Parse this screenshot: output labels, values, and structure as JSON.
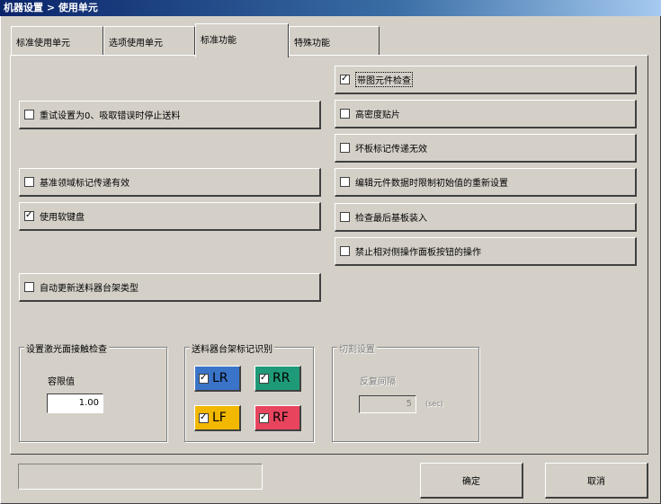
{
  "window": {
    "title": "机器设置 > 使用单元"
  },
  "tabs": [
    {
      "label": "标准使用单元"
    },
    {
      "label": "选项使用单元"
    },
    {
      "label": "标准功能"
    },
    {
      "label": "特殊功能"
    }
  ],
  "left_options": [
    {
      "label": "重试设置为0、吸取错误时停止送料",
      "checked": false
    },
    {
      "label": "基准领域标记传递有效",
      "checked": false
    },
    {
      "label": "使用软键盘",
      "checked": true
    },
    {
      "label": "自动更新送料器台架类型",
      "checked": false
    }
  ],
  "right_options": [
    {
      "label": "带图元件检查",
      "checked": true
    },
    {
      "label": "高密度贴片",
      "checked": false
    },
    {
      "label": "坏板标记传递无效",
      "checked": false
    },
    {
      "label": "编辑元件数据时限制初始值的重新设置",
      "checked": false
    },
    {
      "label": "检查最后基板装入",
      "checked": false
    },
    {
      "label": "禁止相对侧操作面板按钮的操作",
      "checked": false
    }
  ],
  "laser_group": {
    "title": "设置激光面接触检查",
    "tolerance_label": "容限值",
    "tolerance_value": "1.00"
  },
  "feeder_group": {
    "title": "送料器台架标记识别",
    "buttons": [
      {
        "label": "LR",
        "checked": true,
        "color": "#3a74c8"
      },
      {
        "label": "RR",
        "checked": true,
        "color": "#1f9a78"
      },
      {
        "label": "LF",
        "checked": true,
        "color": "#f2b800"
      },
      {
        "label": "RF",
        "checked": true,
        "color": "#e8445e"
      }
    ]
  },
  "cut_group": {
    "title": "切割设置",
    "interval_label": "反复间隔",
    "interval_value": "5",
    "interval_unit": "(sec)"
  },
  "footer": {
    "ok_label": "确定",
    "cancel_label": "取消"
  }
}
